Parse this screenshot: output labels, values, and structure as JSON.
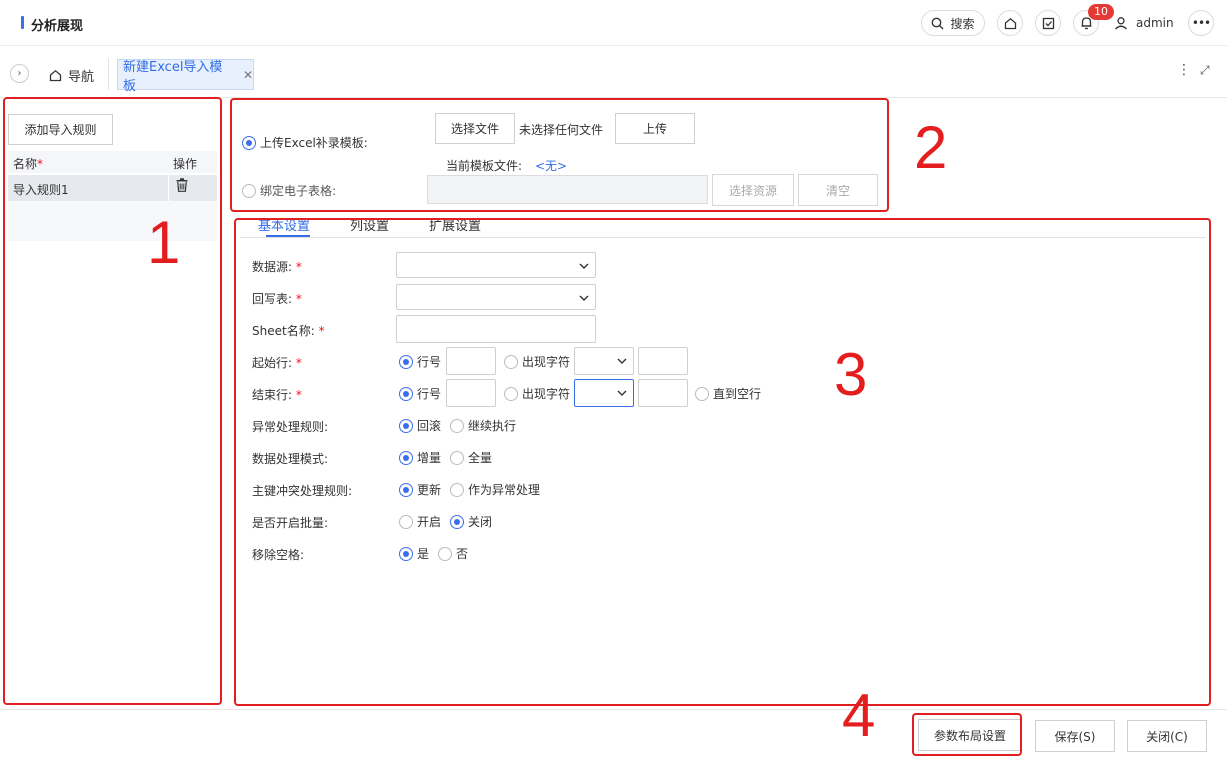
{
  "header": {
    "title": "分析展现",
    "search_label": "搜索",
    "notification_count": "10",
    "username": "admin",
    "accent_color": "#3a6fe8"
  },
  "tabs": {
    "home_label": "导航",
    "active_tab_label": "新建Excel导入模板"
  },
  "left_panel": {
    "add_rule_label": "添加导入规则",
    "col_name": "名称",
    "col_name_required": "*",
    "col_action": "操作",
    "rules": [
      {
        "name": "导入规则1"
      }
    ]
  },
  "upload": {
    "upload_option_label": "上传Excel补录模板:",
    "choose_file_label": "选择文件",
    "no_file_text": "未选择任何文件",
    "upload_button_label": "上传",
    "current_template_label": "当前模板文件:",
    "current_template_value": "<无>",
    "bind_option_label": "绑定电子表格:",
    "select_resource_label": "选择资源",
    "clear_label": "清空"
  },
  "settings_tabs": [
    "基本设置",
    "列设置",
    "扩展设置"
  ],
  "form": {
    "datasource_label": "数据源:",
    "writeback_label": "回写表:",
    "sheet_label": "Sheet名称:",
    "start_row_label": "起始行:",
    "end_row_label": "结束行:",
    "required_mark": "*",
    "row_number_option": "行号",
    "char_option": "出现字符",
    "until_blank_option": "直到空行",
    "exception_label": "异常处理规则:",
    "exception_options": [
      "回滚",
      "继续执行"
    ],
    "mode_label": "数据处理模式:",
    "mode_options": [
      "增量",
      "全量"
    ],
    "pk_label": "主键冲突处理规则:",
    "pk_options": [
      "更新",
      "作为异常处理"
    ],
    "batch_label": "是否开启批量:",
    "batch_options": [
      "开启",
      "关闭"
    ],
    "trim_label": "移除空格:",
    "trim_options": [
      "是",
      "否"
    ]
  },
  "annotations": [
    "1",
    "2",
    "3",
    "4"
  ],
  "footer": {
    "param_layout_label": "参数布局设置",
    "save_label": "保存(S)",
    "close_label": "关闭(C)"
  }
}
